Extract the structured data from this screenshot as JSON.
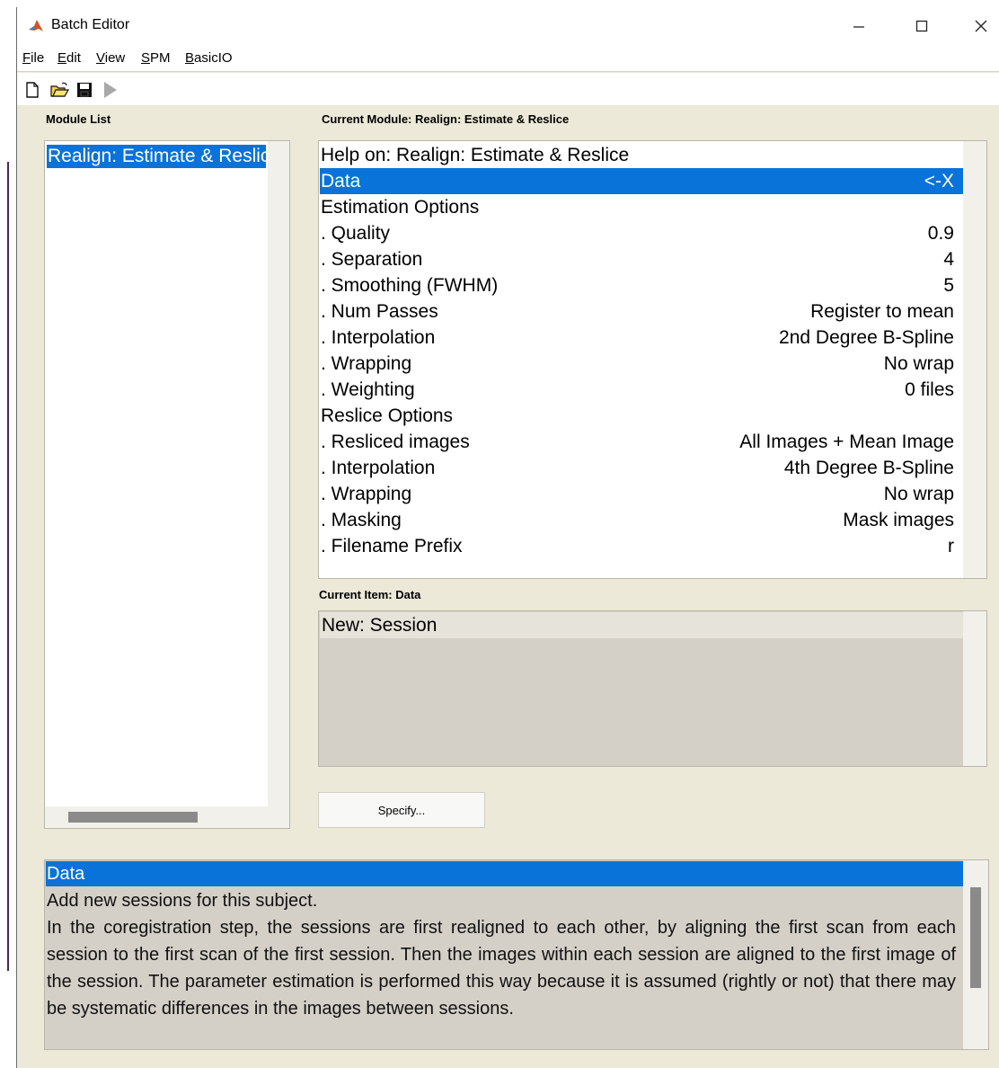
{
  "window": {
    "title": "Batch Editor"
  },
  "menu": [
    {
      "label": "File",
      "accel": "F"
    },
    {
      "label": "Edit",
      "accel": "E"
    },
    {
      "label": "View",
      "accel": "V"
    },
    {
      "label": "SPM",
      "accel": "S"
    },
    {
      "label": "BasicIO",
      "accel": "B"
    }
  ],
  "toolbar": {
    "icons": [
      "new-icon",
      "open-icon",
      "save-icon",
      "run-icon"
    ]
  },
  "module_list": {
    "label": "Module List",
    "items": [
      "Realign: Estimate & Reslice"
    ]
  },
  "current_module": {
    "label": "Current Module: Realign: Estimate & Reslice",
    "rows": [
      {
        "label": "Help on: Realign: Estimate & Reslice",
        "value": ""
      },
      {
        "label": "Data",
        "value": "<-X",
        "selected": true
      },
      {
        "label": "Estimation Options",
        "value": ""
      },
      {
        "label": ". Quality",
        "value": "0.9"
      },
      {
        "label": ". Separation",
        "value": "4"
      },
      {
        "label": ". Smoothing (FWHM)",
        "value": "5"
      },
      {
        "label": ". Num Passes",
        "value": "Register to mean"
      },
      {
        "label": ". Interpolation",
        "value": "2nd Degree B-Spline"
      },
      {
        "label": ". Wrapping",
        "value": "No wrap"
      },
      {
        "label": ". Weighting",
        "value": "0 files"
      },
      {
        "label": "Reslice Options",
        "value": ""
      },
      {
        "label": ". Resliced images",
        "value": "All Images + Mean Image"
      },
      {
        "label": ". Interpolation",
        "value": "4th Degree B-Spline"
      },
      {
        "label": ". Wrapping",
        "value": "No wrap"
      },
      {
        "label": ". Masking",
        "value": "Mask images"
      },
      {
        "label": ". Filename Prefix",
        "value": "r"
      }
    ]
  },
  "current_item": {
    "label": "Current Item: Data",
    "items": [
      "New: Session"
    ],
    "button": "Specify..."
  },
  "help": {
    "title": "Data",
    "lines": [
      "Add new sessions for this subject.",
      "In the coregistration step, the sessions are first realigned to each other, by aligning the first scan from each session to the first scan of the first session. Then the images within each session are aligned to the first image of the session. The parameter estimation is performed this way because it is assumed (rightly or not) that there may be systematic differences in the images between sessions."
    ]
  },
  "colors": {
    "selection": "#0a73d9",
    "panel_bg": "#ece9d8",
    "list_bg": "#d4d0c8"
  }
}
